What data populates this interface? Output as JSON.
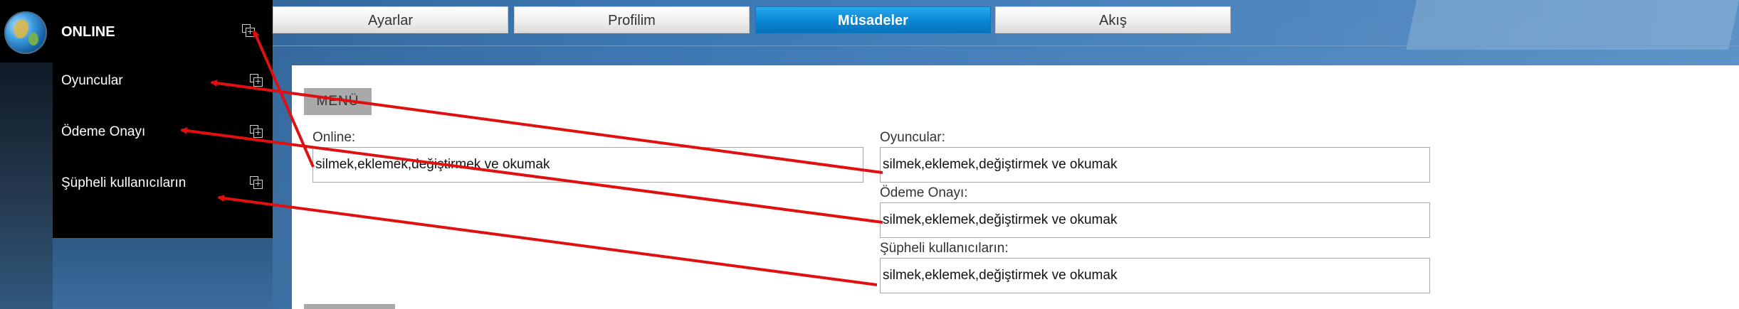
{
  "sidebar": {
    "title": "ONLINE",
    "items": [
      {
        "label": "Oyuncular"
      },
      {
        "label": "Ödeme Onayı"
      },
      {
        "label": "Şüpheli kullanıcıların"
      }
    ]
  },
  "tabs": [
    {
      "label": "Ayarlar",
      "active": false
    },
    {
      "label": "Profilim",
      "active": false
    },
    {
      "label": "Müsadeler",
      "active": true
    },
    {
      "label": "Akış",
      "active": false
    }
  ],
  "content": {
    "menu_button": "MENÜ",
    "fields": [
      {
        "label": "Online:",
        "value": "silmek,eklemek,değiştirmek ve okumak"
      },
      {
        "label": "Oyuncular:",
        "value": "silmek,eklemek,değiştirmek ve okumak"
      },
      {
        "label": "Ödeme Onayı:",
        "value": "silmek,eklemek,değiştirmek ve okumak"
      },
      {
        "label": "Şüpheli kullanıcıların:",
        "value": "silmek,eklemek,değiştirmek ve okumak"
      }
    ]
  },
  "colors": {
    "active_tab": "#0a86d4",
    "annotation_arrow": "#e01010",
    "sidebar_bg": "#000000"
  },
  "icons": [
    "globe-logo-icon",
    "new-window-icon"
  ]
}
